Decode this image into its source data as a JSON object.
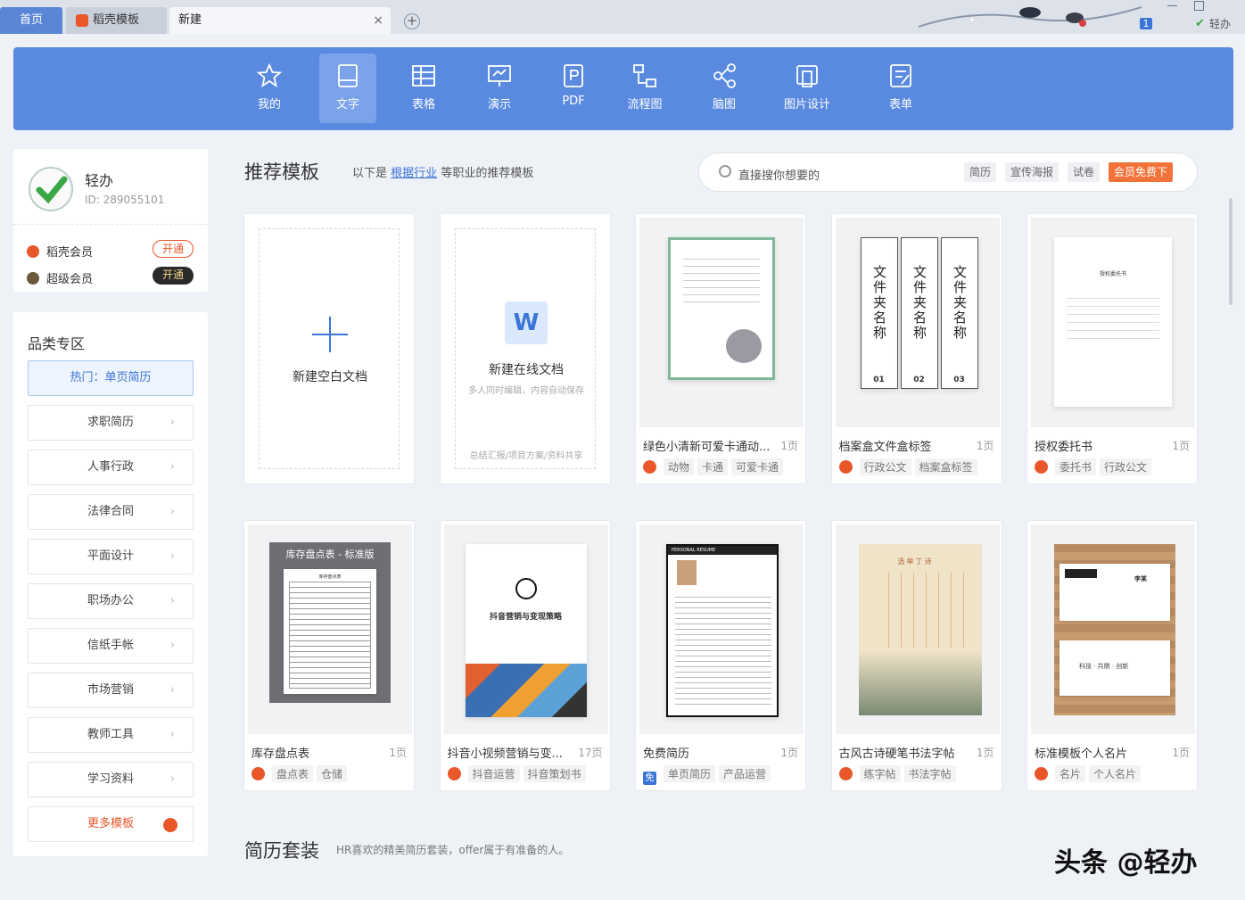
{
  "tabs": {
    "home": "首页",
    "docer": "稻壳模板",
    "new": "新建",
    "close": "×",
    "add": "+"
  },
  "titlebar": {
    "badge": "1",
    "user": "轻办"
  },
  "categories": [
    {
      "label": "我的",
      "icon": "star-icon"
    },
    {
      "label": "文字",
      "icon": "document-icon"
    },
    {
      "label": "表格",
      "icon": "table-icon"
    },
    {
      "label": "演示",
      "icon": "presentation-icon"
    },
    {
      "label": "PDF",
      "icon": "pdf-icon"
    },
    {
      "label": "流程图",
      "icon": "flowchart-icon"
    },
    {
      "label": "脑图",
      "icon": "mindmap-icon"
    },
    {
      "label": "图片设计",
      "icon": "image-design-icon"
    },
    {
      "label": "表单",
      "icon": "form-icon"
    }
  ],
  "user": {
    "name": "轻办",
    "id": "ID: 289055101",
    "memberships": [
      {
        "label": "稻壳会员",
        "button": "开通",
        "color": "#e8562a"
      },
      {
        "label": "超级会员",
        "button": "开通",
        "color": "#6b5a3a"
      }
    ]
  },
  "sidebar": {
    "title": "品类专区",
    "hot": "热门：单页简历",
    "items": [
      "求职简历",
      "人事行政",
      "法律合同",
      "平面设计",
      "职场办公",
      "信纸手帐",
      "市场营销",
      "教师工具",
      "学习资料"
    ],
    "more": "更多模板",
    "chevron": "›"
  },
  "recommend": {
    "title": "推荐模板",
    "desc_prefix": "以下是",
    "desc_link": "根据行业",
    "desc_suffix": "等职业的推荐模板"
  },
  "search": {
    "placeholder": "直接搜你想要的",
    "tags": [
      "简历",
      "宣传海报",
      "试卷"
    ],
    "vip": "会员免费下"
  },
  "new_blank": {
    "label": "新建空白文档"
  },
  "new_online": {
    "label": "新建在线文档",
    "sub": "多人同时编辑，内容自动保存",
    "footer": "总结汇报/项目方案/资料共享"
  },
  "templates_row1": [
    {
      "title": "绿色小清新可爱卡通动...",
      "pages": "1页",
      "tags": [
        "动物",
        "卡通",
        "可爱卡通"
      ]
    },
    {
      "title": "档案盒文件盒标签",
      "pages": "1页",
      "tags": [
        "行政公文",
        "档案盒标签"
      ]
    },
    {
      "title": "授权委托书",
      "pages": "1页",
      "tags": [
        "委托书",
        "行政公文"
      ]
    }
  ],
  "templates_row2": [
    {
      "title": "库存盘点表",
      "pages": "1页",
      "tags": [
        "盘点表",
        "仓储"
      ]
    },
    {
      "title": "抖音小视频营销与变...",
      "pages": "17页",
      "tags": [
        "抖音运营",
        "抖音策划书"
      ]
    },
    {
      "title": "免费简历",
      "pages": "1页",
      "tags": [
        "单页简历",
        "产品运营"
      ]
    },
    {
      "title": "古风古诗硬笔书法字帖",
      "pages": "1页",
      "tags": [
        "练字帖",
        "书法字帖"
      ]
    },
    {
      "title": "标准模板个人名片",
      "pages": "1页",
      "tags": [
        "名片",
        "个人名片"
      ]
    }
  ],
  "thumb_text": {
    "inventory_header": "库存盘点表 - 标准版",
    "inventory_sheet": "库存盘点表",
    "douyin": "抖音营销与变现策略",
    "free_badge": "免",
    "folder_label": "文件夹名称",
    "folder_nums": [
      "01",
      "02",
      "03"
    ],
    "card_name": "李某",
    "card_bottom": "科技 · 共鼎 · 创新",
    "resume_head": "PERSONAL RESUME",
    "auth_title": "授权委托书",
    "poem_title": "选举丁诗"
  },
  "resume_section": {
    "title": "简历套装",
    "desc": "HR喜欢的精美简历套装，offer属于有准备的人。"
  },
  "watermark": "头条 @轻办"
}
